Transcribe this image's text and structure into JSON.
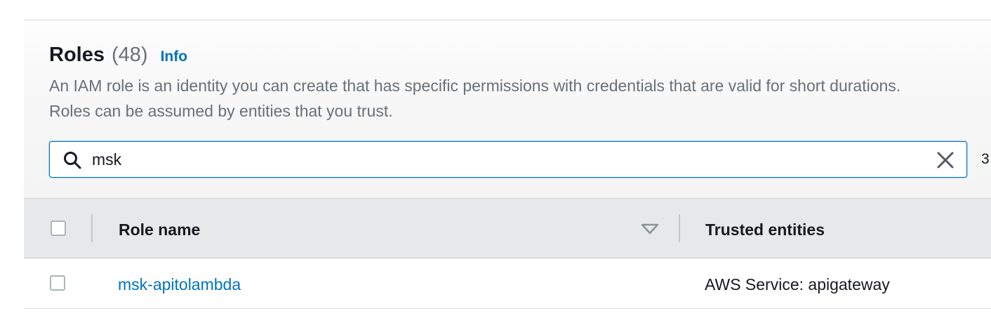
{
  "header": {
    "title": "Roles",
    "count": "(48)",
    "info_label": "Info"
  },
  "description": {
    "line1": "An IAM role is an identity you can create that has specific permissions with credentials that are valid for short durations.",
    "line2": "Roles can be assumed by entities that you trust."
  },
  "search": {
    "value": "msk",
    "match_count": "3"
  },
  "table": {
    "columns": [
      {
        "label": "Role name",
        "sortable": true
      },
      {
        "label": "Trusted entities",
        "sortable": false
      }
    ],
    "rows": [
      {
        "role_name": "msk-apitolambda",
        "trusted_entities": "AWS Service: apigateway"
      }
    ]
  },
  "colors": {
    "link": "#0073bb",
    "muted_text": "#687078",
    "focus_border": "#0073bb"
  },
  "icons": {
    "search": "search-icon",
    "clear": "close-icon",
    "sort": "sort-down-icon"
  }
}
